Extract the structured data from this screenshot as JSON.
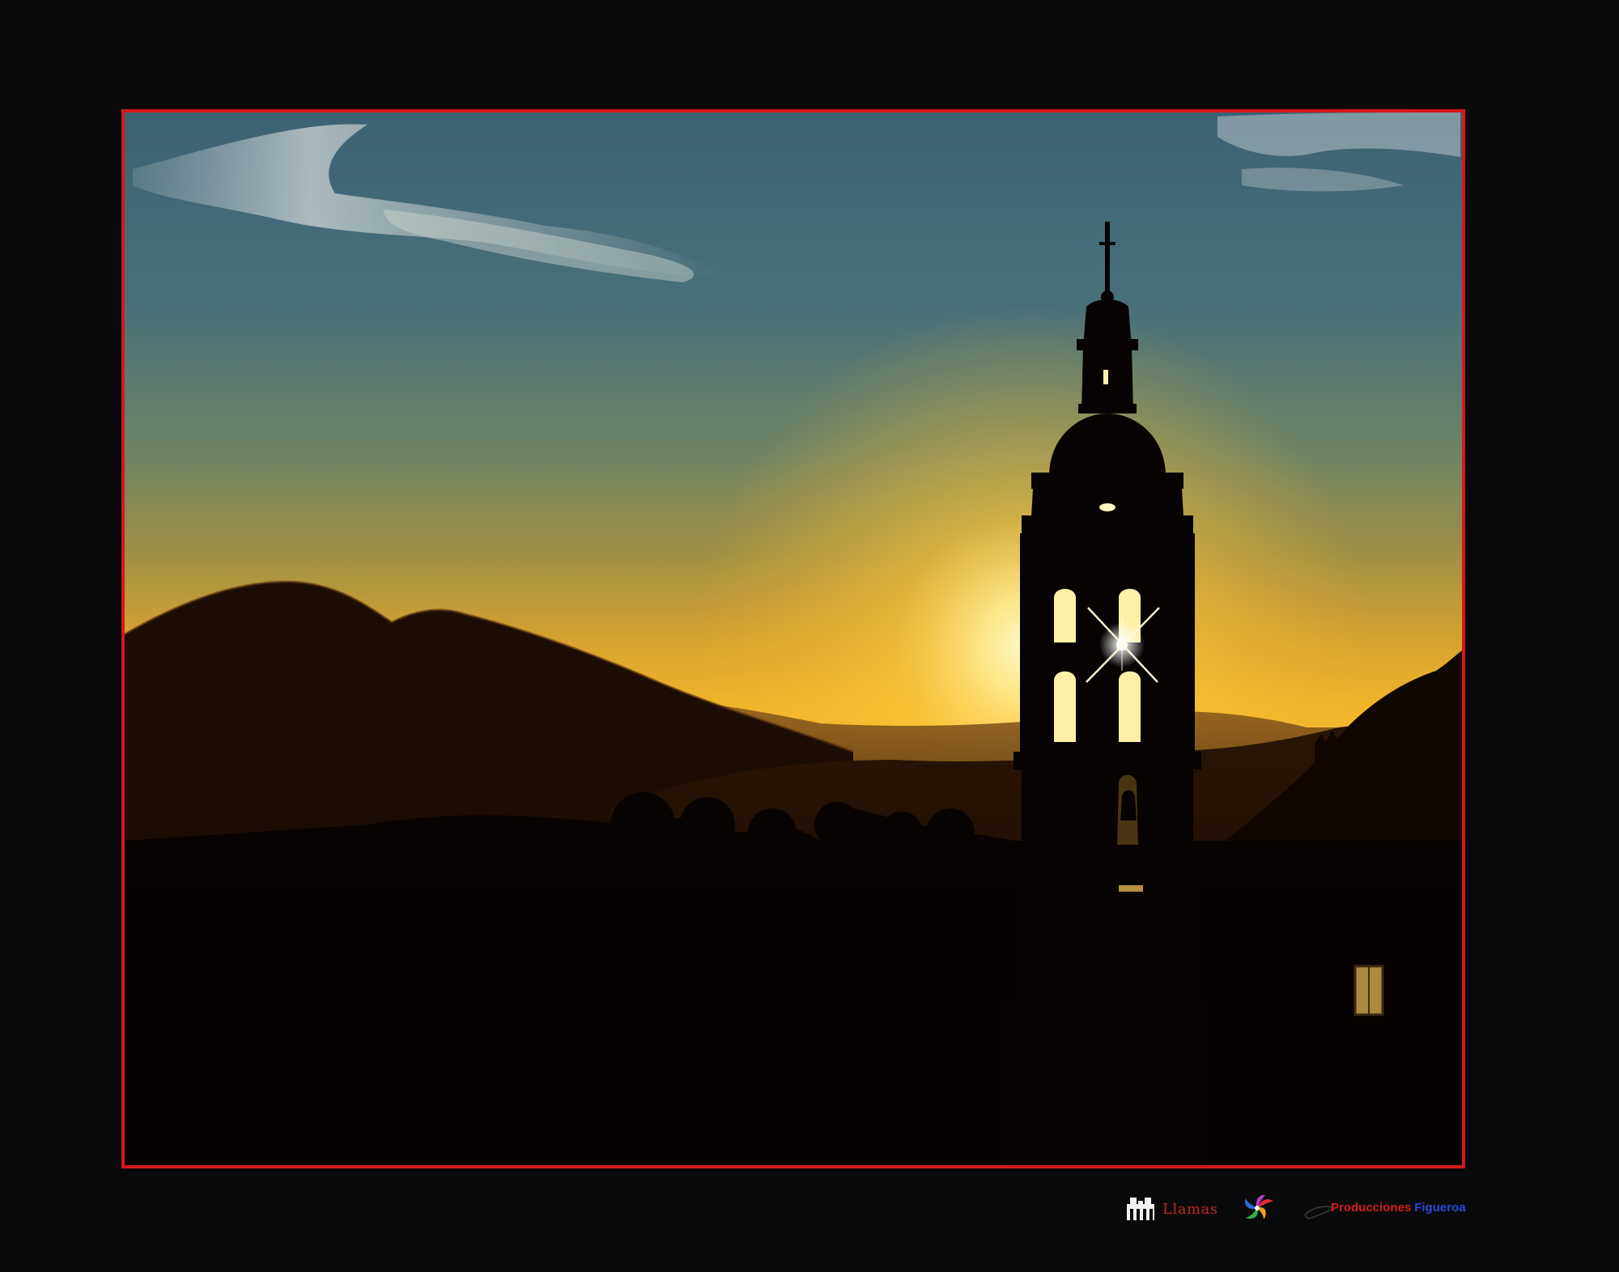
{
  "photo": {
    "subject": "church-bell-tower-silhouette-at-sunset",
    "border_color": "#d81818",
    "sky_top_color": "#3f6476",
    "sky_horizon_color": "#f2b52a",
    "sun_color": "#fff3a0"
  },
  "footer": {
    "logo_llamas_text": "Llamas",
    "logo_swirl_icon": "swirl-icon",
    "producciones_text": "Producciones",
    "figueroa_text": "Figueroa"
  },
  "colors": {
    "page_background": "#0a0a0c",
    "producciones_red": "#d21e1e",
    "figueroa_blue": "#2a48d8"
  }
}
